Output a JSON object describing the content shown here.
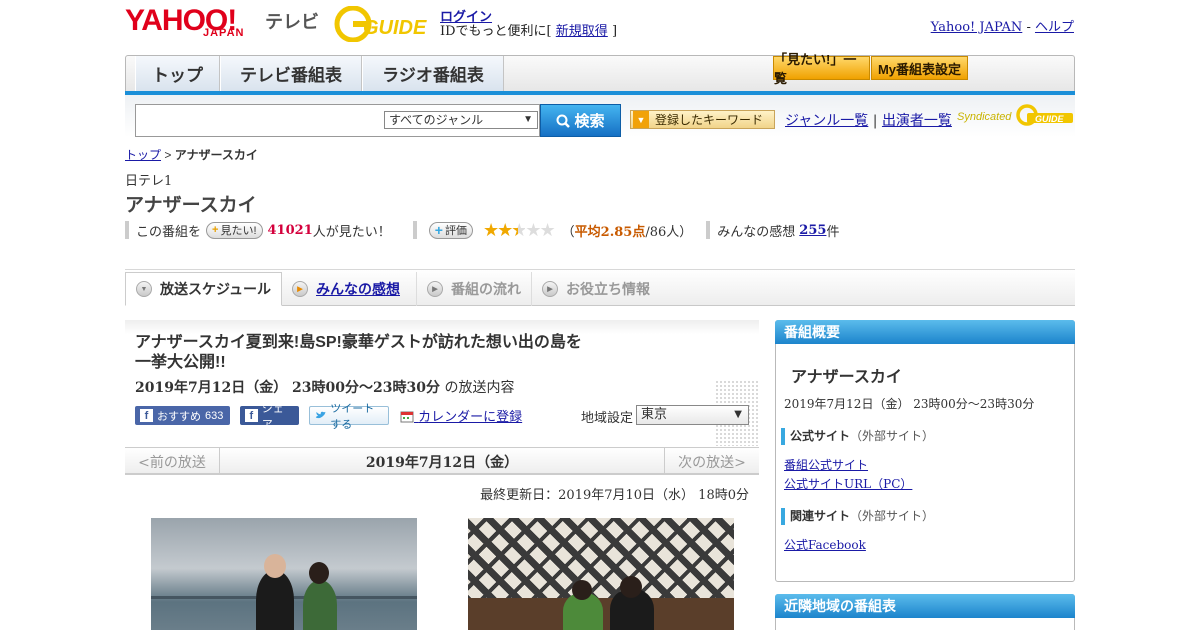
{
  "header": {
    "logo_yahoo": "YAHOO!",
    "logo_japan": "JAPAN",
    "logo_tv": "テレビ",
    "logo_gguide": "GUIDE",
    "login_link": "ログイン",
    "login_sub_prefix": "IDでもっと便利に[",
    "register_link": "新規取得",
    "login_sub_suffix": "]",
    "yahoo_japan_link": "Yahoo! JAPAN",
    "separator": "-",
    "help_link": "ヘルプ"
  },
  "nav": {
    "tabs": [
      "トップ",
      "テレビ番組表",
      "ラジオ番組表"
    ],
    "mitai_list": "「見たい!」一覧",
    "my_schedule": "My番組表設定"
  },
  "search": {
    "genre_selected": "すべてのジャンル",
    "button_label": "検索",
    "keyword_button": "登録したキーワード",
    "genre_list_link": "ジャンル一覧",
    "divider": "|",
    "cast_list_link": "出演者一覧",
    "syndicated": "Syndicated"
  },
  "breadcrumb": {
    "top": "トップ",
    "sep": ">",
    "current": "アナザースカイ"
  },
  "program": {
    "station": "日テレ1",
    "title": "アナザースカイ",
    "mitai_prefix": "この番組を",
    "mitai_button": "見たい!",
    "mitai_count": "41021",
    "mitai_suffix": "人が見たい！",
    "rate_button": "評価",
    "rating": 2.85,
    "avg_open": "（",
    "avg_label": "平均2.85点",
    "avg_votes": "/86人）",
    "review_label": "みんなの感想",
    "review_count": "255",
    "review_unit": "件"
  },
  "subtabs": [
    "放送スケジュール",
    "みんなの感想",
    "番組の流れ",
    "お役立ち情報"
  ],
  "episode": {
    "title_line1": "アナザースカイ夏到来!島SP!豪華ゲストが訪れた想い出の島を",
    "title_line2": "一挙大公開!!",
    "time_bold": "2019年7月12日（金）  23時00分～23時30分",
    "time_suffix": "の放送内容",
    "fb_recommend": "おすすめ",
    "fb_count": "633",
    "fb_share": "シェア",
    "tweet": "ツイートする",
    "calendar": "カレンダーに登録",
    "region_label": "地域設定",
    "region_selected": "東京"
  },
  "pager": {
    "prev": "<前の放送",
    "date": "2019年7月12日（金）",
    "next": "次の放送>"
  },
  "updated": "最終更新日：2019年7月10日（水） 18時0分",
  "sidebar": {
    "overview_header": "番組概要",
    "title": "アナザースカイ",
    "time": "2019年7月12日（金） 23時00分～23時30分",
    "official_section": "公式サイト",
    "external_note": "（外部サイト）",
    "links_official": [
      "番組公式サイト",
      "公式サイトURL（PC）"
    ],
    "related_section": "関連サイト",
    "links_related": [
      "公式Facebook"
    ],
    "nearby_header": "近隣地域の番組表"
  },
  "colors": {
    "accent_blue": "#1b8fd8",
    "yahoo_red": "#e0001b",
    "star": "#f0a800"
  }
}
